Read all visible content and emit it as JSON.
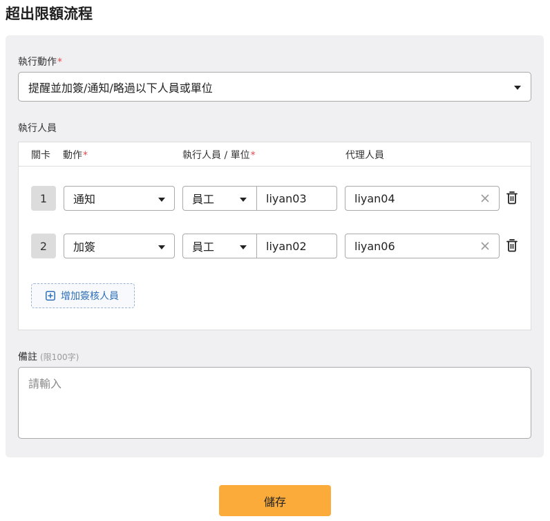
{
  "page": {
    "title": "超出限額流程"
  },
  "form": {
    "action": {
      "label": "執行動作",
      "required_mark": "*",
      "value": "提醒並加簽/通知/略過以下人員或單位"
    },
    "executors": {
      "label": "執行人員",
      "columns": {
        "step": "關卡",
        "action": "動作",
        "required_mark": "*",
        "executor": "執行人員 / 單位",
        "delegate": "代理人員"
      },
      "rows": [
        {
          "step": "1",
          "action": "通知",
          "executor_type": "員工",
          "executor": "liyan03",
          "delegate": "liyan04"
        },
        {
          "step": "2",
          "action": "加簽",
          "executor_type": "員工",
          "executor": "liyan02",
          "delegate": "liyan06"
        }
      ],
      "add_button": "增加簽核人員"
    },
    "remark": {
      "label": "備註",
      "hint": "(限100字)",
      "placeholder": "請輸入",
      "value": ""
    }
  },
  "footer": {
    "save_label": "儲存"
  },
  "colors": {
    "accent": "#fbab3a",
    "link": "#2d6fb8",
    "required": "#e5484d",
    "panel": "#f0f0f2"
  },
  "icons": [
    "caret-down-icon",
    "clear-icon",
    "trash-icon",
    "plus-square-icon"
  ]
}
